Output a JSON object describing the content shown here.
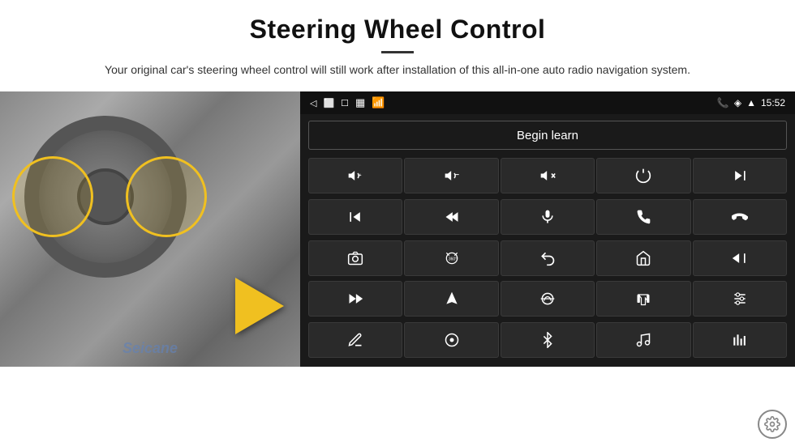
{
  "header": {
    "title": "Steering Wheel Control",
    "subtitle": "Your original car's steering wheel control will still work after installation of this all-in-one auto radio navigation system."
  },
  "status_bar": {
    "left_icons": [
      "back-icon",
      "home-icon",
      "square-icon",
      "grid-icon",
      "signal-icon"
    ],
    "time": "15:52",
    "right_icons": [
      "phone-icon",
      "wifi-icon",
      "signal-icon",
      "time-label"
    ]
  },
  "begin_learn_btn": "Begin learn",
  "grid_buttons": [
    {
      "id": "vol-up",
      "icon": "🔊+",
      "unicode": "🔊"
    },
    {
      "id": "vol-down",
      "icon": "🔉−",
      "unicode": "🔉"
    },
    {
      "id": "mute",
      "icon": "🔇",
      "unicode": "🔇"
    },
    {
      "id": "power",
      "icon": "⏻",
      "unicode": "⏻"
    },
    {
      "id": "prev-track",
      "icon": "⏮",
      "unicode": "⏮"
    },
    {
      "id": "next-track",
      "icon": "⏭",
      "unicode": "⏭"
    },
    {
      "id": "ff",
      "icon": "⏩",
      "unicode": "⏩"
    },
    {
      "id": "mic",
      "icon": "🎤",
      "unicode": "🎤"
    },
    {
      "id": "phone",
      "icon": "📞",
      "unicode": "📞"
    },
    {
      "id": "hang-up",
      "icon": "📵",
      "unicode": "📵"
    },
    {
      "id": "camera",
      "icon": "📷",
      "unicode": "📷"
    },
    {
      "id": "rotate360",
      "icon": "360",
      "unicode": "360"
    },
    {
      "id": "back",
      "icon": "↩",
      "unicode": "↩"
    },
    {
      "id": "home",
      "icon": "🏠",
      "unicode": "🏠"
    },
    {
      "id": "rewind",
      "icon": "⏪",
      "unicode": "⏪"
    },
    {
      "id": "fast-fwd2",
      "icon": "⏭",
      "unicode": "⏭"
    },
    {
      "id": "nav",
      "icon": "▲",
      "unicode": "▲"
    },
    {
      "id": "switch",
      "icon": "⇄",
      "unicode": "⇄"
    },
    {
      "id": "record",
      "icon": "⏺",
      "unicode": "⏺"
    },
    {
      "id": "sliders",
      "icon": "⚙",
      "unicode": "⚙"
    },
    {
      "id": "pen",
      "icon": "✏",
      "unicode": "✏"
    },
    {
      "id": "circle-btn",
      "icon": "⊙",
      "unicode": "⊙"
    },
    {
      "id": "bluetooth",
      "icon": "⚡",
      "unicode": "⚡"
    },
    {
      "id": "music",
      "icon": "♪",
      "unicode": "♪"
    },
    {
      "id": "equalizer",
      "icon": "|||",
      "unicode": "|||"
    }
  ],
  "seicane_label": "Seicane",
  "gear_button_label": "Settings"
}
